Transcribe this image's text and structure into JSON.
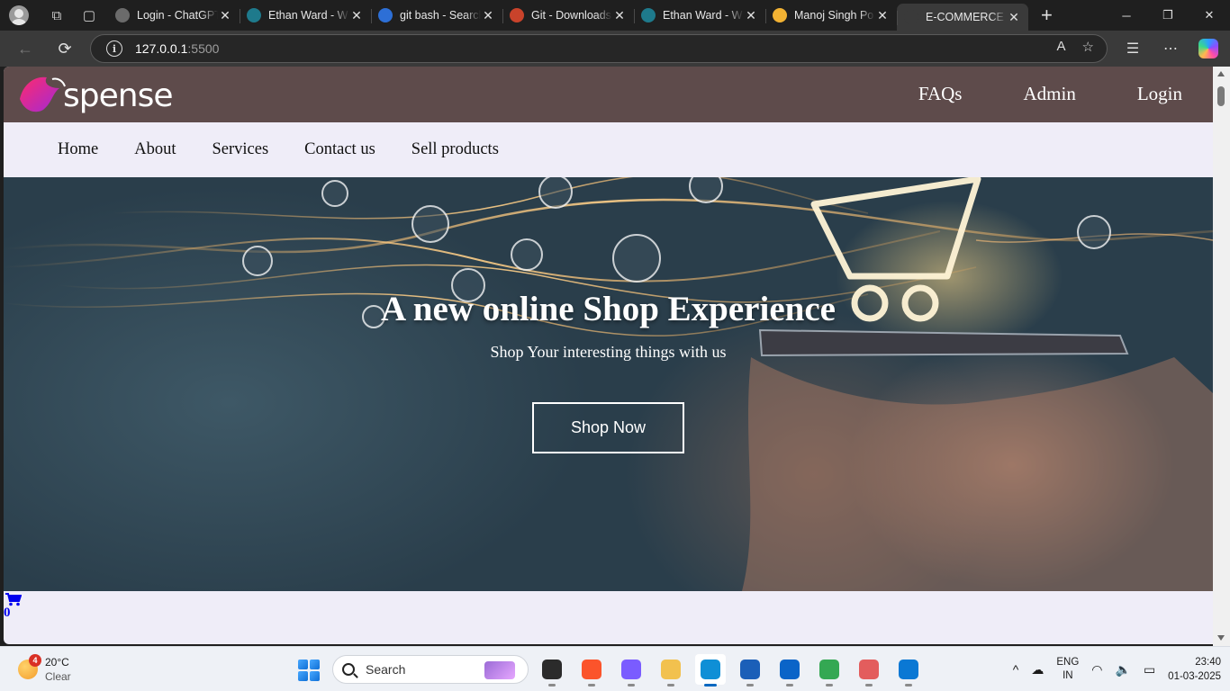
{
  "browser": {
    "tabs": [
      {
        "title": "Login - ChatGPT",
        "icon": "chatgpt-icon",
        "color": "#6b6b6b"
      },
      {
        "title": "Ethan Ward - W",
        "icon": "webflow-icon",
        "color": "#1e7a8c"
      },
      {
        "title": "git bash - Search",
        "icon": "search-icon",
        "color": "#2d6fd6"
      },
      {
        "title": "Git - Downloads",
        "icon": "git-icon",
        "color": "#c9432b"
      },
      {
        "title": "Ethan Ward - W",
        "icon": "webflow-icon",
        "color": "#1e7a8c"
      },
      {
        "title": "Manoj Singh Po",
        "icon": "site-icon",
        "color": "#f2b233"
      },
      {
        "title": "E-COMMERCE W",
        "icon": "globe-icon",
        "color": "#3a3a3a",
        "active": true
      }
    ],
    "url_host": "127.0.0.1",
    "url_port": ":5500"
  },
  "site": {
    "logo_text": "spense",
    "header_links": [
      "FAQs",
      "Admin",
      "Login"
    ],
    "nav_links": [
      "Home",
      "About",
      "Services",
      "Contact us",
      "Sell products"
    ],
    "hero": {
      "title": "A new online Shop Experience",
      "subtitle": "Shop Your interesting things with us",
      "cta": "Shop Now"
    },
    "cart_count": "0",
    "colors": {
      "header_bg": "#5e4b4b",
      "nav_bg": "#efedf8",
      "cart": "#0000ee",
      "logo_gradient": [
        "#ff2a6d",
        "#a12ad6"
      ]
    }
  },
  "taskbar": {
    "weather_badge": "4",
    "temperature": "20°C",
    "condition": "Clear",
    "search_placeholder": "Search",
    "apps": [
      {
        "name": "task-view",
        "color": "#2b2b2b"
      },
      {
        "name": "brave",
        "color": "#fb542b"
      },
      {
        "name": "copilot",
        "color": "#7a5cff"
      },
      {
        "name": "file-explorer",
        "color": "#f2c14e"
      },
      {
        "name": "edge",
        "color": "#0f8fd6",
        "active": true
      },
      {
        "name": "microsoft-store",
        "color": "#1b5fb8"
      },
      {
        "name": "outlook",
        "color": "#0a64c8"
      },
      {
        "name": "chrome",
        "color": "#34a853"
      },
      {
        "name": "git-gui",
        "color": "#e35d5d"
      },
      {
        "name": "vscode",
        "color": "#0a78d4"
      }
    ],
    "lang_top": "ENG",
    "lang_bottom": "IN",
    "time": "23:40",
    "date": "01-03-2025"
  }
}
